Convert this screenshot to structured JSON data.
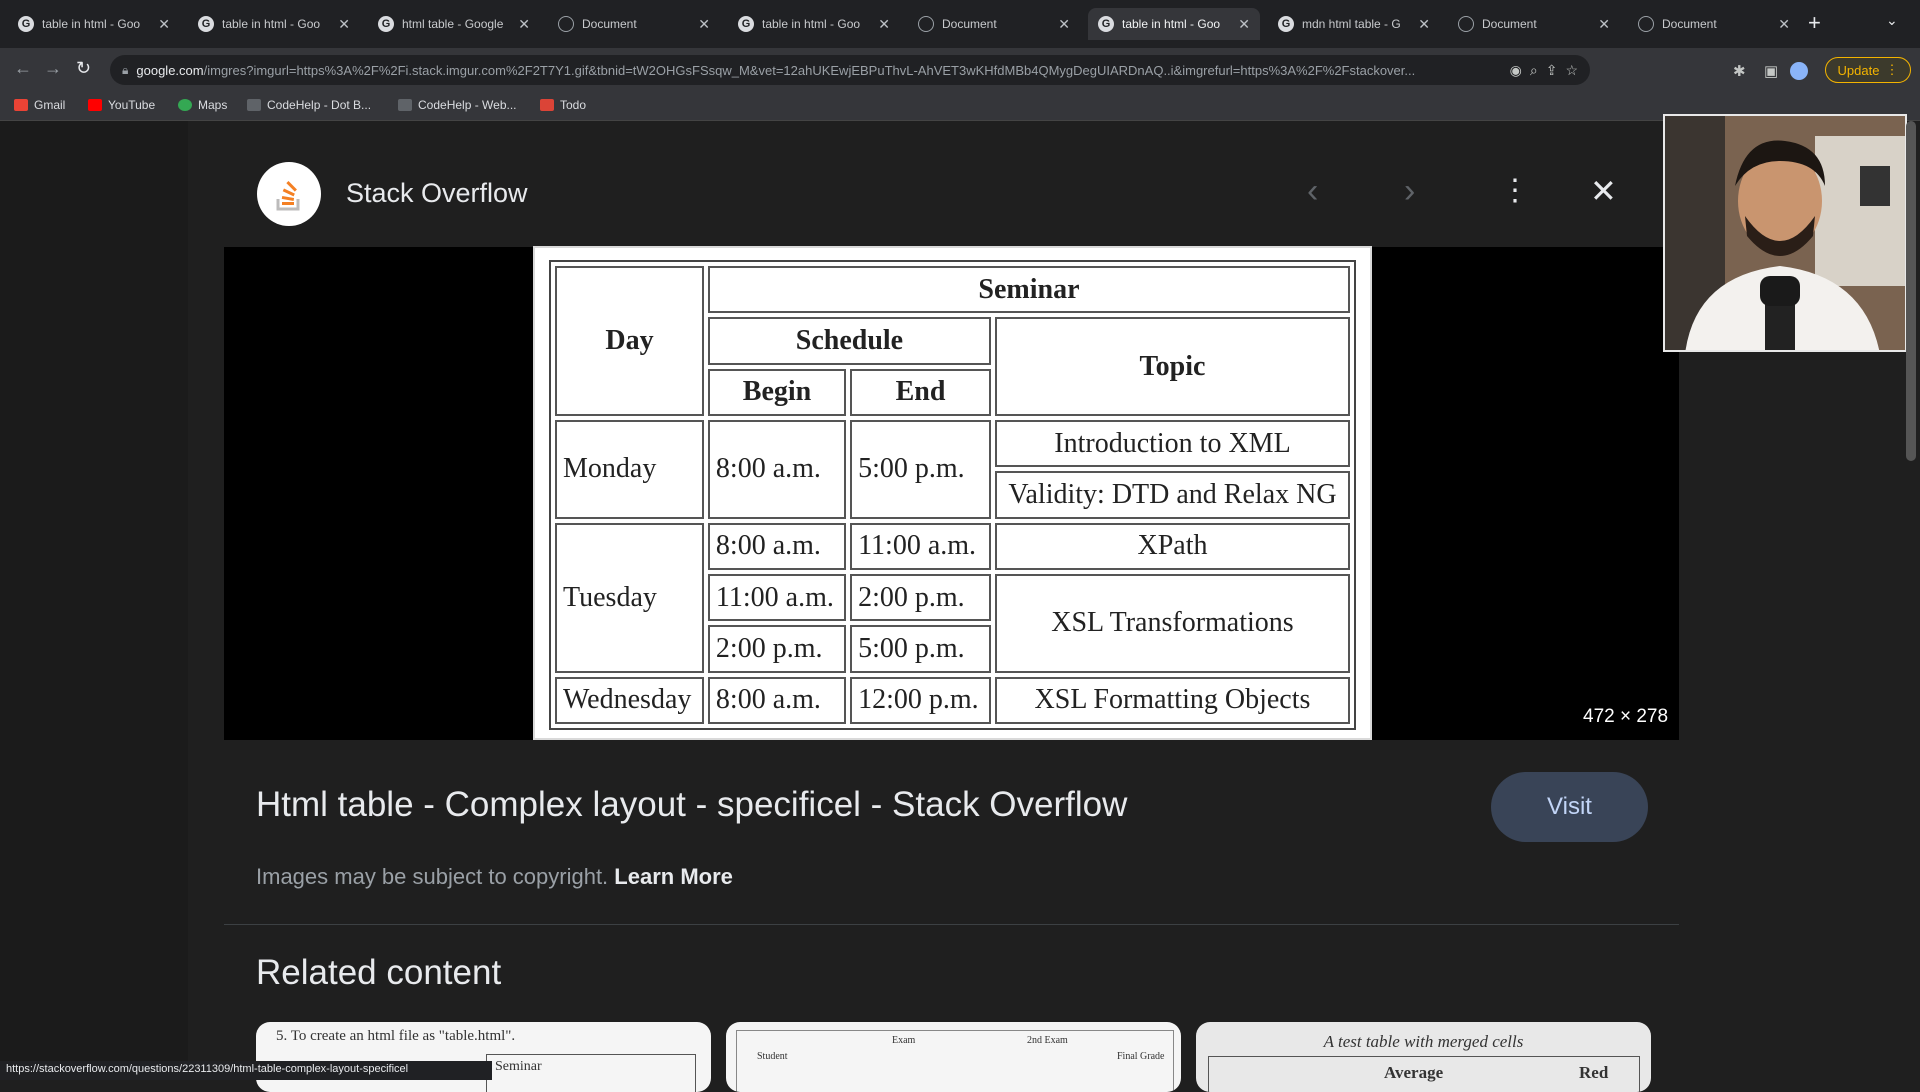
{
  "tabs": [
    {
      "title": "table in html - Goo",
      "icon": "google-icon",
      "active": false
    },
    {
      "title": "table in html - Goo",
      "icon": "google-icon",
      "active": false
    },
    {
      "title": "html table - Google",
      "icon": "google-icon",
      "active": false
    },
    {
      "title": "Document",
      "icon": "globe-icon",
      "active": false
    },
    {
      "title": "table in html - Goo",
      "icon": "google-icon",
      "active": false
    },
    {
      "title": "Document",
      "icon": "globe-icon",
      "active": false
    },
    {
      "title": "table in html - Goo",
      "icon": "google-icon",
      "active": true
    },
    {
      "title": "mdn html table - G",
      "icon": "google-icon",
      "active": false
    },
    {
      "title": "Document",
      "icon": "globe-icon",
      "active": false
    },
    {
      "title": "Document",
      "icon": "globe-icon",
      "active": false
    }
  ],
  "toolbar": {
    "url_host": "google.com",
    "url_rest": "/imgres?imgurl=https%3A%2F%2Fi.stack.imgur.com%2F2T7Y1.gif&tbnid=tW2OHGsFSsqw_M&vet=12ahUKEwjEBPuThvL-AhVET3wKHfdMBb4QMygDegUIARDnAQ..i&imgrefurl=https%3A%2F%2Fstackover...",
    "update_label": "Update"
  },
  "bookmarks": [
    {
      "label": "Gmail",
      "color": "#ea4335"
    },
    {
      "label": "YouTube",
      "color": "#ff0000"
    },
    {
      "label": "Maps",
      "color": "#34a853"
    },
    {
      "label": "CodeHelp - Dot B...",
      "color": "#5f6368"
    },
    {
      "label": "CodeHelp - Web...",
      "color": "#5f6368"
    },
    {
      "label": "Todo",
      "color": "#db4437"
    }
  ],
  "viewer": {
    "source_name": "Stack Overflow",
    "dimensions": "472 × 278",
    "result_title": "Html table - Complex layout - specificel - Stack Overflow",
    "visit_label": "Visit",
    "copyright_text": "Images may be subject to copyright.",
    "learn_more": "Learn More",
    "related_heading": "Related content"
  },
  "seminar_table": {
    "head_day": "Day",
    "head_seminar": "Seminar",
    "head_schedule": "Schedule",
    "head_topic": "Topic",
    "head_begin": "Begin",
    "head_end": "End",
    "rows": {
      "mon_day": "Monday",
      "mon_begin": "8:00 a.m.",
      "mon_end": "5:00 p.m.",
      "mon_topic1": "Introduction to XML",
      "mon_topic2": "Validity: DTD and Relax NG",
      "tue_day": "Tuesday",
      "tue1_begin": "8:00 a.m.",
      "tue1_end": "11:00 a.m.",
      "tue2_begin": "11:00 a.m.",
      "tue2_end": "2:00 p.m.",
      "tue3_begin": "2:00 p.m.",
      "tue3_end": "5:00 p.m.",
      "tue_topic1": "XPath",
      "tue_topic2": "XSL Transformations",
      "wed_day": "Wednesday",
      "wed_begin": "8:00 a.m.",
      "wed_end": "12:00 p.m.",
      "wed_topic": "XSL Formatting Objects"
    }
  },
  "thumbs": {
    "t1_text": "5. To create an html file as \"table.html\".",
    "t1_sub": "Seminar",
    "t2_exam": "Exam",
    "t2_exam2": "2nd Exam",
    "t2_student": "Student",
    "t2_final": "Final Grade",
    "t3_caption": "A test table with merged cells",
    "t3_avg": "Average",
    "t3_red": "Red"
  },
  "statusbar": "https://stackoverflow.com/questions/22311309/html-table-complex-layout-specificel"
}
